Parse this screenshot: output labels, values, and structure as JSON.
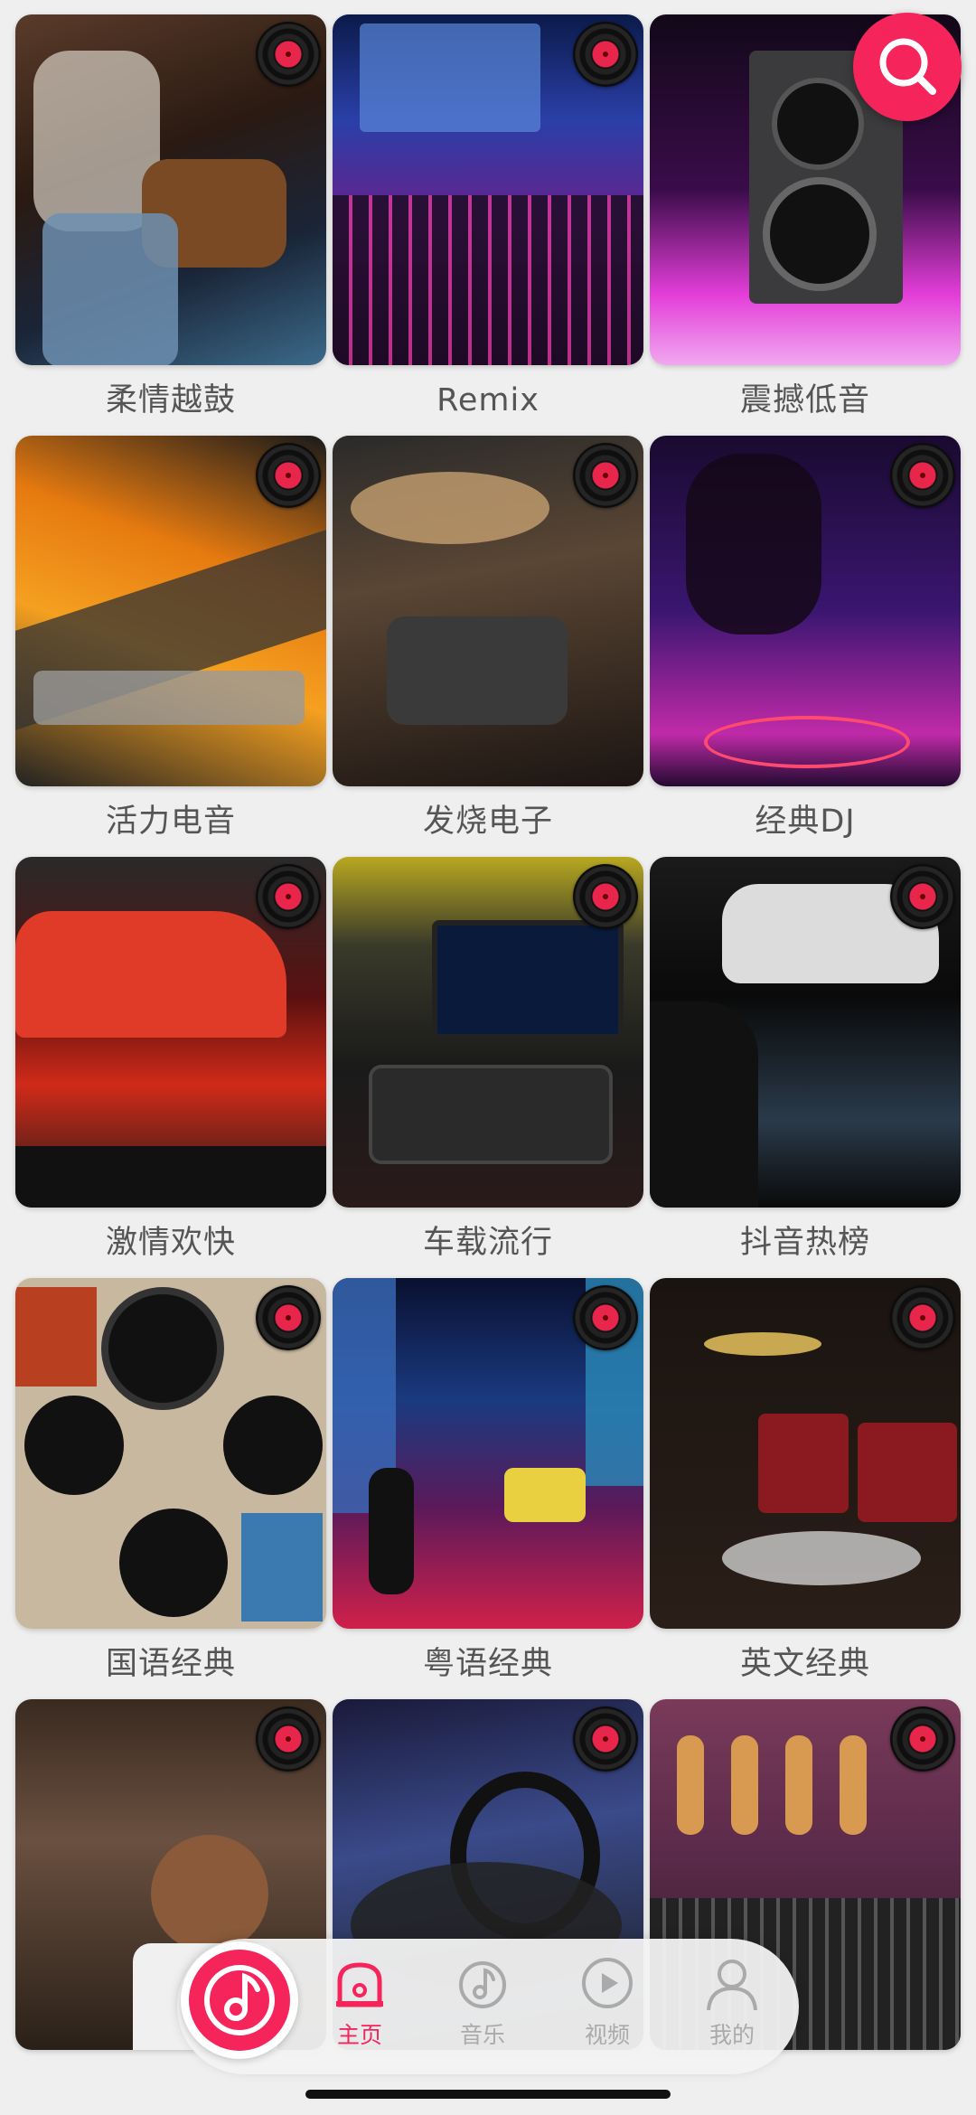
{
  "accent": "#f5245a",
  "categories": [
    {
      "label": "柔情越鼓"
    },
    {
      "label": "Remix"
    },
    {
      "label": "震撼低音"
    },
    {
      "label": "活力电音"
    },
    {
      "label": "发烧电子"
    },
    {
      "label": "经典DJ"
    },
    {
      "label": "激情欢快"
    },
    {
      "label": "车载流行"
    },
    {
      "label": "抖音热榜"
    },
    {
      "label": "国语经典"
    },
    {
      "label": "粤语经典"
    },
    {
      "label": "英文经典"
    }
  ],
  "search": {
    "icon": "search-icon"
  },
  "tabbar": {
    "center_icon": "music-note-icon",
    "tabs": [
      {
        "label": "主页",
        "icon": "home-icon",
        "active": true
      },
      {
        "label": "音乐",
        "icon": "music-icon",
        "active": false
      },
      {
        "label": "视频",
        "icon": "video-icon",
        "active": false
      },
      {
        "label": "我的",
        "icon": "profile-icon",
        "active": false
      }
    ]
  }
}
